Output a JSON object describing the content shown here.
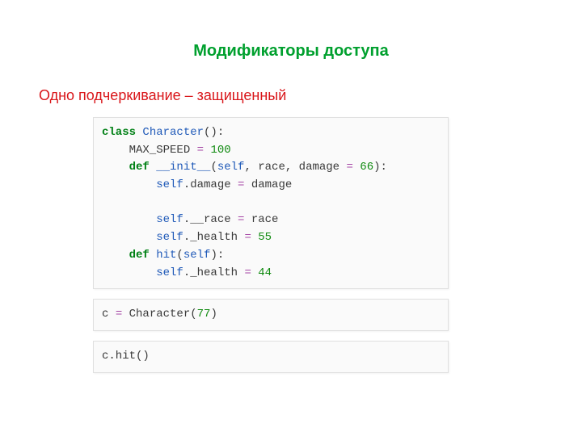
{
  "title": "Модификаторы доступа",
  "subtitle": "Одно подчеркивание – защищенный",
  "code": {
    "block1": {
      "l1_kw": "class",
      "l1_name": " Character",
      "l1_rest": "():",
      "l2": "    MAX_SPEED ",
      "l2_op": "=",
      "l2_sp": " ",
      "l2_num": "100",
      "l3_kw": "    def",
      "l3_name": " __init__",
      "l3_open": "(",
      "l3_self": "self",
      "l3_mid": ", race, damage ",
      "l3_op": "=",
      "l3_sp": " ",
      "l3_num": "66",
      "l3_close": "):",
      "l4_a": "        self",
      "l4_b": ".damage ",
      "l4_op": "=",
      "l4_c": " damage",
      "l5": "",
      "l6_a": "        self",
      "l6_b": ".__race ",
      "l6_op": "=",
      "l6_c": " race",
      "l7_a": "        self",
      "l7_b": "._health ",
      "l7_op": "=",
      "l7_sp": " ",
      "l7_num": "55",
      "l8_kw": "    def",
      "l8_name": " hit",
      "l8_open": "(",
      "l8_self": "self",
      "l8_close": "):",
      "l9_a": "        self",
      "l9_b": "._health ",
      "l9_op": "=",
      "l9_sp": " ",
      "l9_num": "44"
    },
    "block2": {
      "a": "c ",
      "op": "=",
      "b": " Character(",
      "num": "77",
      "c": ")"
    },
    "block3": {
      "a": "c",
      "b": ".hit()"
    }
  }
}
